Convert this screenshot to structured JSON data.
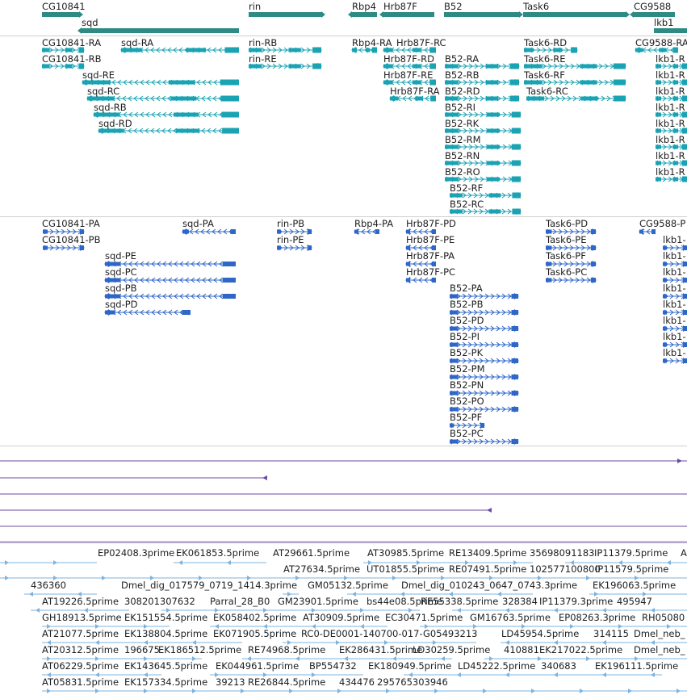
{
  "colors": {
    "gene": "#2e8b84",
    "transcript": "#1ba3b3",
    "protein": "#2f67c8",
    "rna_seq": "#6a4ca3",
    "est": "#7fb3dc",
    "separator": "#cfcfcf",
    "text": "#1e1e1e"
  },
  "gene_track": [
    {
      "id": "cg10841",
      "label": "CG10841"
    },
    {
      "id": "sqd",
      "label": "sqd"
    },
    {
      "id": "rin",
      "label": "rin"
    },
    {
      "id": "rbp4",
      "label": "Rbp4"
    },
    {
      "id": "hrb87f",
      "label": "Hrb87F"
    },
    {
      "id": "b52",
      "label": "B52"
    },
    {
      "id": "task6",
      "label": "Task6"
    },
    {
      "id": "cg9588",
      "label": "CG9588"
    },
    {
      "id": "lkb1",
      "label": "lkb1"
    }
  ],
  "transcript_track": [
    {
      "id": "cg10841-ra",
      "label": "CG10841-RA"
    },
    {
      "id": "cg10841-rb",
      "label": "CG10841-RB"
    },
    {
      "id": "sqd-ra",
      "label": "sqd-RA"
    },
    {
      "id": "sqd-re",
      "label": "sqd-RE"
    },
    {
      "id": "sqd-rc",
      "label": "sqd-RC"
    },
    {
      "id": "sqd-rb",
      "label": "sqd-RB"
    },
    {
      "id": "sqd-rd",
      "label": "sqd-RD"
    },
    {
      "id": "rin-rb",
      "label": "rin-RB"
    },
    {
      "id": "rin-re",
      "label": "rin-RE"
    },
    {
      "id": "rbp4-ra",
      "label": "Rbp4-RA"
    },
    {
      "id": "hrb87f-rc",
      "label": "Hrb87F-RC"
    },
    {
      "id": "hrb87f-rd",
      "label": "Hrb87F-RD"
    },
    {
      "id": "hrb87f-re",
      "label": "Hrb87F-RE"
    },
    {
      "id": "hrb87f-ra",
      "label": "Hrb87F-RA"
    },
    {
      "id": "b52-ra",
      "label": "B52-RA"
    },
    {
      "id": "b52-rb",
      "label": "B52-RB"
    },
    {
      "id": "b52-rd",
      "label": "B52-RD"
    },
    {
      "id": "b52-ri",
      "label": "B52-RI"
    },
    {
      "id": "b52-rk",
      "label": "B52-RK"
    },
    {
      "id": "b52-rm",
      "label": "B52-RM"
    },
    {
      "id": "b52-rn",
      "label": "B52-RN"
    },
    {
      "id": "b52-ro",
      "label": "B52-RO"
    },
    {
      "id": "b52-rf",
      "label": "B52-RF"
    },
    {
      "id": "b52-rc",
      "label": "B52-RC"
    },
    {
      "id": "task6-rd",
      "label": "Task6-RD"
    },
    {
      "id": "task6-re",
      "label": "Task6-RE"
    },
    {
      "id": "task6-rf",
      "label": "Task6-RF"
    },
    {
      "id": "task6-rc",
      "label": "Task6-RC"
    },
    {
      "id": "cg9588-ra",
      "label": "CG9588-RA"
    },
    {
      "id": "lkb1-r1",
      "label": "lkb1-R"
    },
    {
      "id": "lkb1-r2",
      "label": "lkb1-R"
    },
    {
      "id": "lkb1-r3",
      "label": "lkb1-R"
    },
    {
      "id": "lkb1-r4",
      "label": "lkb1-R"
    },
    {
      "id": "lkb1-r5",
      "label": "lkb1-R"
    },
    {
      "id": "lkb1-r6",
      "label": "lkb1-R"
    },
    {
      "id": "lkb1-r7",
      "label": "lkb1-R"
    },
    {
      "id": "lkb1-r8",
      "label": "lkb1-R"
    }
  ],
  "protein_track": [
    {
      "id": "cg10841-pa",
      "label": "CG10841-PA"
    },
    {
      "id": "cg10841-pb",
      "label": "CG10841-PB"
    },
    {
      "id": "sqd-pa",
      "label": "sqd-PA"
    },
    {
      "id": "sqd-pe",
      "label": "sqd-PE"
    },
    {
      "id": "sqd-pc",
      "label": "sqd-PC"
    },
    {
      "id": "sqd-pb",
      "label": "sqd-PB"
    },
    {
      "id": "sqd-pd",
      "label": "sqd-PD"
    },
    {
      "id": "rin-pb",
      "label": "rin-PB"
    },
    {
      "id": "rin-pe",
      "label": "rin-PE"
    },
    {
      "id": "rbp4-pa",
      "label": "Rbp4-PA"
    },
    {
      "id": "hrb87f-pd",
      "label": "Hrb87F-PD"
    },
    {
      "id": "hrb87f-pe",
      "label": "Hrb87F-PE"
    },
    {
      "id": "hrb87f-pa",
      "label": "Hrb87F-PA"
    },
    {
      "id": "hrb87f-pc",
      "label": "Hrb87F-PC"
    },
    {
      "id": "b52-pa",
      "label": "B52-PA"
    },
    {
      "id": "b52-pb",
      "label": "B52-PB"
    },
    {
      "id": "b52-pd",
      "label": "B52-PD"
    },
    {
      "id": "b52-pi",
      "label": "B52-PI"
    },
    {
      "id": "b52-pk",
      "label": "B52-PK"
    },
    {
      "id": "b52-pm",
      "label": "B52-PM"
    },
    {
      "id": "b52-pn",
      "label": "B52-PN"
    },
    {
      "id": "b52-po",
      "label": "B52-PO"
    },
    {
      "id": "b52-pf",
      "label": "B52-PF"
    },
    {
      "id": "b52-pc",
      "label": "B52-PC"
    },
    {
      "id": "task6-pd",
      "label": "Task6-PD"
    },
    {
      "id": "task6-pe",
      "label": "Task6-PE"
    },
    {
      "id": "task6-pf",
      "label": "Task6-PF"
    },
    {
      "id": "task6-pc",
      "label": "Task6-PC"
    },
    {
      "id": "cg9588-p",
      "label": "CG9588-P"
    },
    {
      "id": "lkb1-p1",
      "label": "lkb1-"
    },
    {
      "id": "lkb1-p2",
      "label": "lkb1-"
    },
    {
      "id": "lkb1-p3",
      "label": "lkb1-"
    },
    {
      "id": "lkb1-p4",
      "label": "lkb1-"
    },
    {
      "id": "lkb1-p5",
      "label": "lkb1-"
    },
    {
      "id": "lkb1-p6",
      "label": "lkb1-"
    },
    {
      "id": "lkb1-p7",
      "label": "lkb1-"
    },
    {
      "id": "lkb1-p8",
      "label": "lkb1-"
    }
  ],
  "rna_track_lines": 6,
  "est_track": [
    {
      "id": "ep02408",
      "label": "EP02408.3prime"
    },
    {
      "id": "ek061853",
      "label": "EK061853.5prime"
    },
    {
      "id": "at29661",
      "label": "AT29661.5prime"
    },
    {
      "id": "at30985",
      "label": "AT30985.5prime"
    },
    {
      "id": "re13409",
      "label": "RE13409.5prime"
    },
    {
      "id": "n35698091183",
      "label": "35698091183"
    },
    {
      "id": "ip11379",
      "label": "IP11379.5prime"
    },
    {
      "id": "a-r1",
      "label": "A"
    },
    {
      "id": "at27634",
      "label": "AT27634.5prime"
    },
    {
      "id": "ut01855",
      "label": "UT01855.5prime"
    },
    {
      "id": "re07491",
      "label": "RE07491.5prime"
    },
    {
      "id": "n102577100800",
      "label": "102577100800"
    },
    {
      "id": "ip11579",
      "label": "IP11579.5prime"
    },
    {
      "id": "n436360",
      "label": "436360"
    },
    {
      "id": "dmel-dig-017579",
      "label": "Dmel_dig_017579_0719_1414.3prime"
    },
    {
      "id": "gm05132",
      "label": "GM05132.5prime"
    },
    {
      "id": "dmel-dig-010243",
      "label": "Dmel_dig_010243_0647_0743.3prime"
    },
    {
      "id": "ek196063",
      "label": "EK196063.5prime"
    },
    {
      "id": "at19226",
      "label": "AT19226.5prime"
    },
    {
      "id": "n308201307632",
      "label": "308201307632"
    },
    {
      "id": "parral-28-b0",
      "label": "Parral_28_B0"
    },
    {
      "id": "gm23901",
      "label": "GM23901.5prime"
    },
    {
      "id": "bs44e08",
      "label": "bs44e08.5prime"
    },
    {
      "id": "re55338",
      "label": "RE55338.5prime"
    },
    {
      "id": "n328384",
      "label": "328384"
    },
    {
      "id": "ip11379-3",
      "label": "IP11379.3prime"
    },
    {
      "id": "n495947",
      "label": "495947"
    },
    {
      "id": "gh18913",
      "label": "GH18913.5prime"
    },
    {
      "id": "ek151554",
      "label": "EK151554.5prime"
    },
    {
      "id": "ek058402",
      "label": "EK058402.5prime"
    },
    {
      "id": "at30909",
      "label": "AT30909.5prime"
    },
    {
      "id": "ec30471",
      "label": "EC30471.5prime"
    },
    {
      "id": "gm16763",
      "label": "GM16763.5prime"
    },
    {
      "id": "ep08263",
      "label": "EP08263.3prime"
    },
    {
      "id": "rh05080",
      "label": "RH05080"
    },
    {
      "id": "at21077",
      "label": "AT21077.5prime"
    },
    {
      "id": "ek138804",
      "label": "EK138804.5prime"
    },
    {
      "id": "ek071905",
      "label": "EK071905.5prime"
    },
    {
      "id": "rc0-de0001",
      "label": "RC0-DE0001-140700-017-G05493213"
    },
    {
      "id": "ld45954",
      "label": "LD45954.5prime"
    },
    {
      "id": "n314115",
      "label": "314115"
    },
    {
      "id": "dmel-neb-1",
      "label": "Dmel_neb_"
    },
    {
      "id": "at20312",
      "label": "AT20312.5prime"
    },
    {
      "id": "n196675",
      "label": "196675"
    },
    {
      "id": "ek186512",
      "label": "EK186512.5prime"
    },
    {
      "id": "re74968",
      "label": "RE74968.5prime"
    },
    {
      "id": "ek286431",
      "label": "EK286431.5prime"
    },
    {
      "id": "ld30259",
      "label": "LD30259.5prime"
    },
    {
      "id": "n410881",
      "label": "410881"
    },
    {
      "id": "ek217022",
      "label": "EK217022.5prime"
    },
    {
      "id": "dmel-neb-2",
      "label": "Dmel_neb_"
    },
    {
      "id": "at06229",
      "label": "AT06229.5prime"
    },
    {
      "id": "ek143645",
      "label": "EK143645.5prime"
    },
    {
      "id": "ek044961",
      "label": "EK044961.5prime"
    },
    {
      "id": "bp554732",
      "label": "BP554732"
    },
    {
      "id": "ek180949",
      "label": "EK180949.5prime"
    },
    {
      "id": "ld45222",
      "label": "LD45222.5prime"
    },
    {
      "id": "n340683",
      "label": "340683"
    },
    {
      "id": "ek196111",
      "label": "EK196111.5prime"
    },
    {
      "id": "at05831",
      "label": "AT05831.5prime"
    },
    {
      "id": "ek157334",
      "label": "EK157334.5prime"
    },
    {
      "id": "n39213",
      "label": "39213"
    },
    {
      "id": "re26844",
      "label": "RE26844.5prime"
    },
    {
      "id": "n434476",
      "label": "434476"
    },
    {
      "id": "n295765303946",
      "label": "295765303946"
    }
  ]
}
